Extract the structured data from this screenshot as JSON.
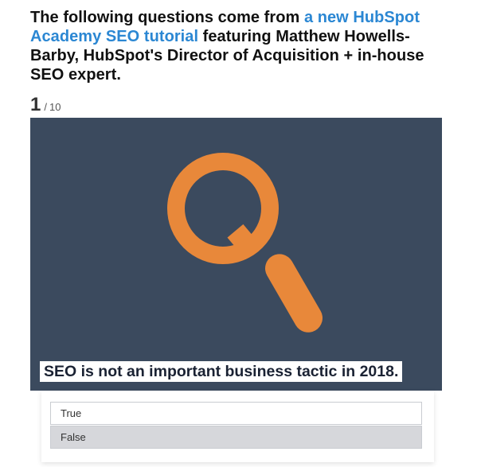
{
  "intro": {
    "prefix": "The following questions come from ",
    "link_text": "a new HubSpot Academy SEO tutorial",
    "suffix": " featuring Matthew Howells-Barby, HubSpot's Director of Acquisition + in-house SEO expert."
  },
  "counter": {
    "current": "1",
    "separator": "/",
    "total": "10"
  },
  "question": {
    "text": "SEO is not an important business tactic in 2018.",
    "icon": "magnifying-glass-icon",
    "background_color": "#3b4a5e",
    "icon_color": "#e8883a"
  },
  "answers": [
    {
      "label": "True",
      "selected": false
    },
    {
      "label": "False",
      "selected": true
    }
  ],
  "colors": {
    "link": "#2b87d3",
    "selected_answer": "#d6d7db"
  }
}
